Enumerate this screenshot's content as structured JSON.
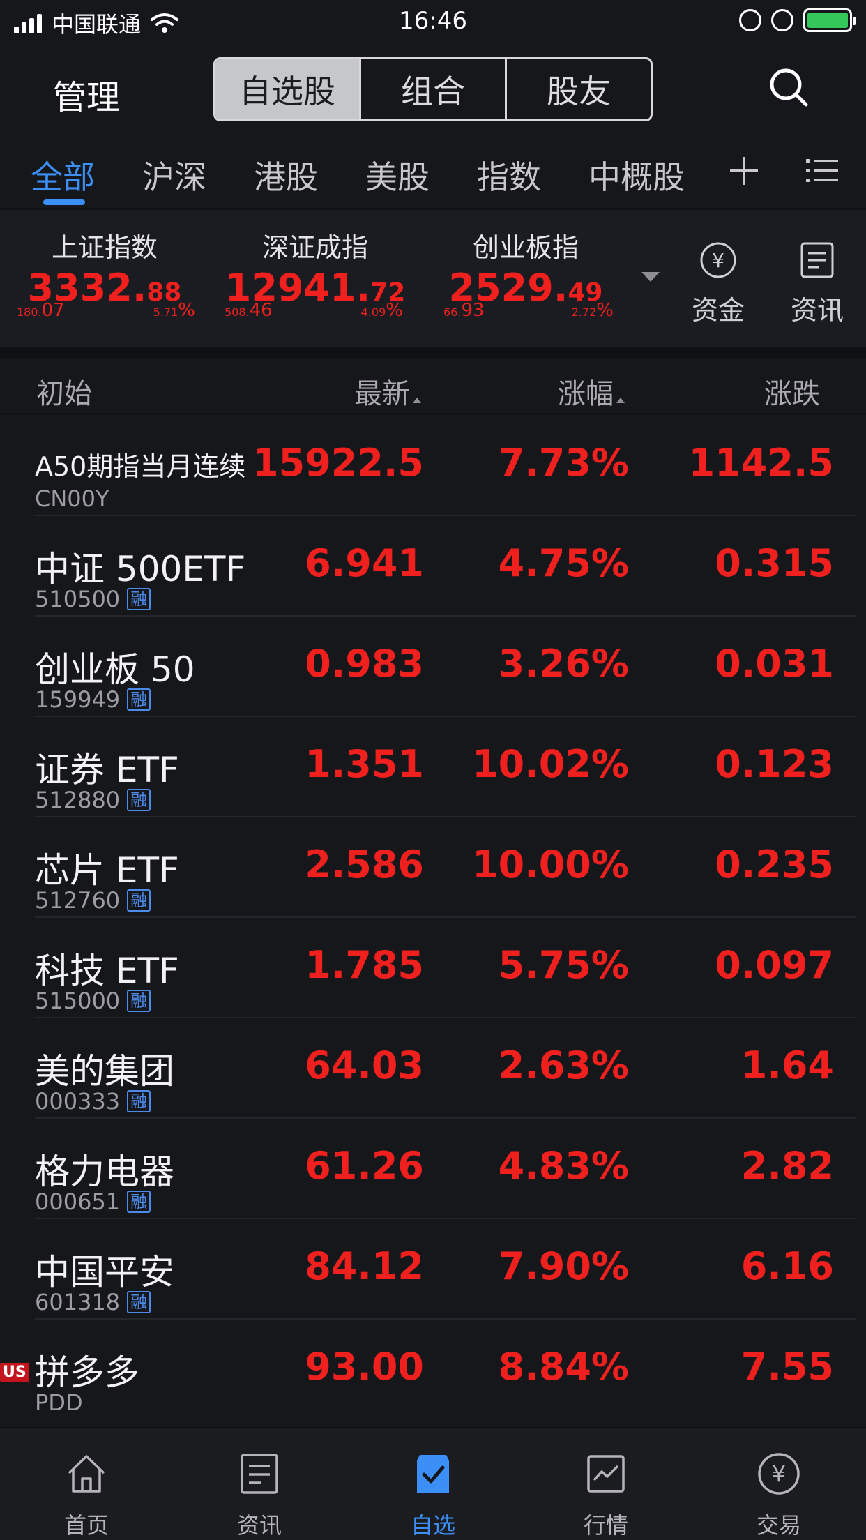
{
  "status_bar": {
    "carrier": "中国联通",
    "time": "16:46"
  },
  "header": {
    "manage_label": "管理",
    "segments": [
      "自选股",
      "组合",
      "股友"
    ],
    "active_segment": "自选股"
  },
  "filter_tabs": [
    "全部",
    "沪深",
    "港股",
    "美股",
    "指数",
    "中概股"
  ],
  "active_filter_tab": "全部",
  "indices": [
    {
      "name": "上证指数",
      "price_int": "3332.",
      "price_dec": "88",
      "change_int": "180.",
      "change_dec": "07",
      "pct_num": "5.71",
      "pct_sign": "%"
    },
    {
      "name": "深证成指",
      "price_int": "12941.",
      "price_dec": "72",
      "change_int": "508.",
      "change_dec": "46",
      "pct_num": "4.09",
      "pct_sign": "%"
    },
    {
      "name": "创业板指",
      "price_int": "2529.",
      "price_dec": "49",
      "change_int": "66.",
      "change_dec": "93",
      "pct_num": "2.72",
      "pct_sign": "%"
    }
  ],
  "quick_links": {
    "funds_label": "资金",
    "news_label": "资讯"
  },
  "columns": {
    "name": "初始",
    "latest": "最新",
    "change_pct": "涨幅",
    "change": "涨跌"
  },
  "rows": [
    {
      "name": "A50期指当月连续",
      "code": "CN00Y",
      "margin": "",
      "latest": "15922.5",
      "change_pct": "7.73%",
      "change": "1142.5"
    },
    {
      "name": "中证 500ETF",
      "code": "510500",
      "margin": "融",
      "latest": "6.941",
      "change_pct": "4.75%",
      "change": "0.315"
    },
    {
      "name": "创业板 50",
      "code": "159949",
      "margin": "融",
      "latest": "0.983",
      "change_pct": "3.26%",
      "change": "0.031"
    },
    {
      "name": "证券 ETF",
      "code": "512880",
      "margin": "融",
      "latest": "1.351",
      "change_pct": "10.02%",
      "change": "0.123"
    },
    {
      "name": "芯片 ETF",
      "code": "512760",
      "margin": "融",
      "latest": "2.586",
      "change_pct": "10.00%",
      "change": "0.235"
    },
    {
      "name": "科技 ETF",
      "code": "515000",
      "margin": "融",
      "latest": "1.785",
      "change_pct": "5.75%",
      "change": "0.097"
    },
    {
      "name": "美的集团",
      "code": "000333",
      "margin": "融",
      "latest": "64.03",
      "change_pct": "2.63%",
      "change": "1.64"
    },
    {
      "name": "格力电器",
      "code": "000651",
      "margin": "融",
      "latest": "61.26",
      "change_pct": "4.83%",
      "change": "2.82"
    },
    {
      "name": "中国平安",
      "code": "601318",
      "margin": "融",
      "latest": "84.12",
      "change_pct": "7.90%",
      "change": "6.16"
    },
    {
      "name": "拼多多",
      "code": "PDD",
      "margin": "",
      "market_badge": "US",
      "latest": "93.00",
      "change_pct": "8.84%",
      "change": "7.55"
    }
  ],
  "bottom_nav": [
    "首页",
    "资讯",
    "自选",
    "行情",
    "交易"
  ],
  "active_nav": "自选",
  "colors": {
    "up_red": "#f0201e",
    "accent_blue": "#3b8ff6",
    "background": "#16171b",
    "battery_green": "#34c759"
  }
}
